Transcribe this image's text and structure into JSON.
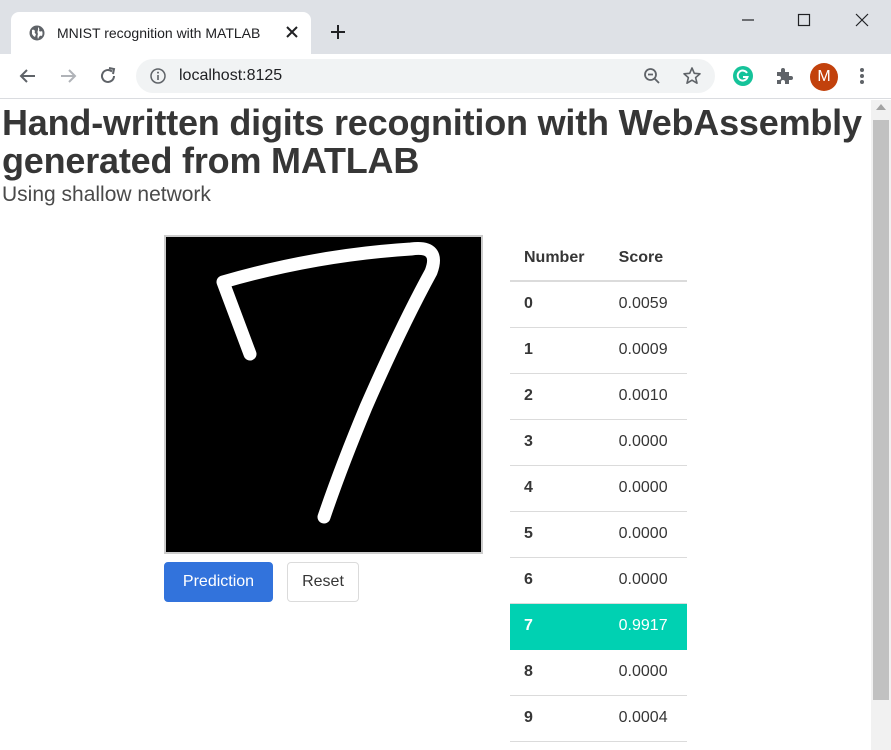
{
  "browser": {
    "tab_title": "MNIST recognition with MATLAB",
    "url": "localhost:8125",
    "profile_initial": "M"
  },
  "page": {
    "title": "Hand-written digits recognition with WebAssembly generated from MATLAB",
    "subtitle": "Using shallow network"
  },
  "buttons": {
    "prediction": "Prediction",
    "reset": "Reset"
  },
  "table": {
    "headers": [
      "Number",
      "Score"
    ],
    "rows": [
      {
        "number": "0",
        "score": "0.0059"
      },
      {
        "number": "1",
        "score": "0.0009"
      },
      {
        "number": "2",
        "score": "0.0010"
      },
      {
        "number": "3",
        "score": "0.0000"
      },
      {
        "number": "4",
        "score": "0.0000"
      },
      {
        "number": "5",
        "score": "0.0000"
      },
      {
        "number": "6",
        "score": "0.0000"
      },
      {
        "number": "7",
        "score": "0.9917"
      },
      {
        "number": "8",
        "score": "0.0000"
      },
      {
        "number": "9",
        "score": "0.0004"
      }
    ],
    "highlighted_row": 7
  },
  "colors": {
    "highlight": "#00d1b2",
    "primary_button": "#3273dc",
    "avatar": "#c2410c"
  }
}
